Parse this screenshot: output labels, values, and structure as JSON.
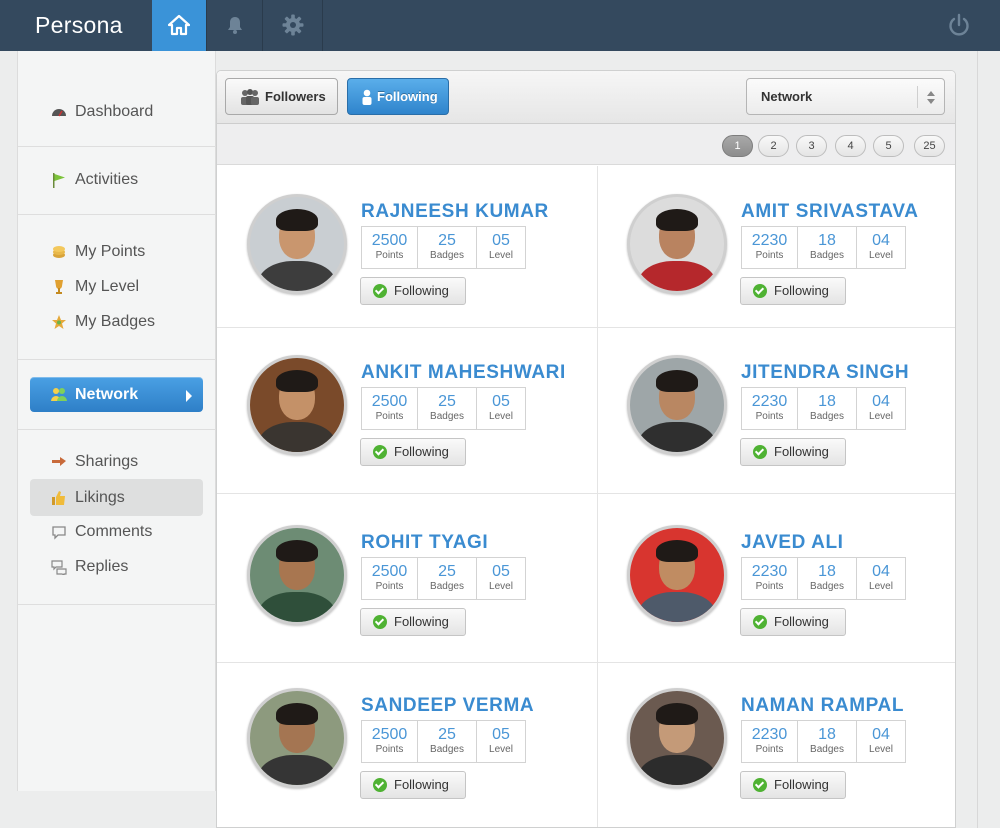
{
  "app": {
    "title": "Persona"
  },
  "colors": {
    "topbar": "#34495e",
    "accent": "#3a93d8",
    "name": "#3a8bd0",
    "check": "#4fb233"
  },
  "nav": {
    "icons": [
      "home-icon",
      "bell-icon",
      "gear-icon",
      "power-icon"
    ]
  },
  "sidebar": {
    "items": [
      {
        "label": "Dashboard",
        "icon": "dashboard-gauge-icon"
      },
      {
        "label": "Activities",
        "icon": "flag-icon"
      },
      {
        "label": "My Points",
        "icon": "coins-icon"
      },
      {
        "label": "My Level",
        "icon": "trophy-icon"
      },
      {
        "label": "My Badges",
        "icon": "badge-icon"
      },
      {
        "label": "Network",
        "icon": "network-people-icon",
        "active": true
      },
      {
        "label": "Sharings",
        "icon": "share-icon"
      },
      {
        "label": "Likings",
        "icon": "thumbs-up-icon"
      },
      {
        "label": "Comments",
        "icon": "comment-icon"
      },
      {
        "label": "Replies",
        "icon": "replies-icon"
      }
    ]
  },
  "toolbar": {
    "followers_label": "Followers",
    "following_label": "Following",
    "select_value": "Network"
  },
  "pagination": {
    "pages": [
      "1",
      "2",
      "3",
      "4",
      "5",
      "25"
    ],
    "current": "1"
  },
  "people": [
    {
      "name": "RAJNEESH KUMAR",
      "points": "2500",
      "badges": "25",
      "level": "05",
      "button": "Following"
    },
    {
      "name": "AMIT SRIVASTAVA",
      "points": "2230",
      "badges": "18",
      "level": "04",
      "button": "Following"
    },
    {
      "name": "ANKIT MAHESHWARI",
      "points": "2500",
      "badges": "25",
      "level": "05",
      "button": "Following"
    },
    {
      "name": "JITENDRA SINGH",
      "points": "2230",
      "badges": "18",
      "level": "04",
      "button": "Following"
    },
    {
      "name": "ROHIT TYAGI",
      "points": "2500",
      "badges": "25",
      "level": "05",
      "button": "Following"
    },
    {
      "name": "JAVED ALI",
      "points": "2230",
      "badges": "18",
      "level": "04",
      "button": "Following"
    },
    {
      "name": "SANDEEP VERMA",
      "points": "2500",
      "badges": "25",
      "level": "05",
      "button": "Following"
    },
    {
      "name": "NAMAN RAMPAL",
      "points": "2230",
      "badges": "18",
      "level": "04",
      "button": "Following"
    }
  ],
  "stat_labels": {
    "points": "Points",
    "badges": "Badges",
    "level": "Level"
  }
}
